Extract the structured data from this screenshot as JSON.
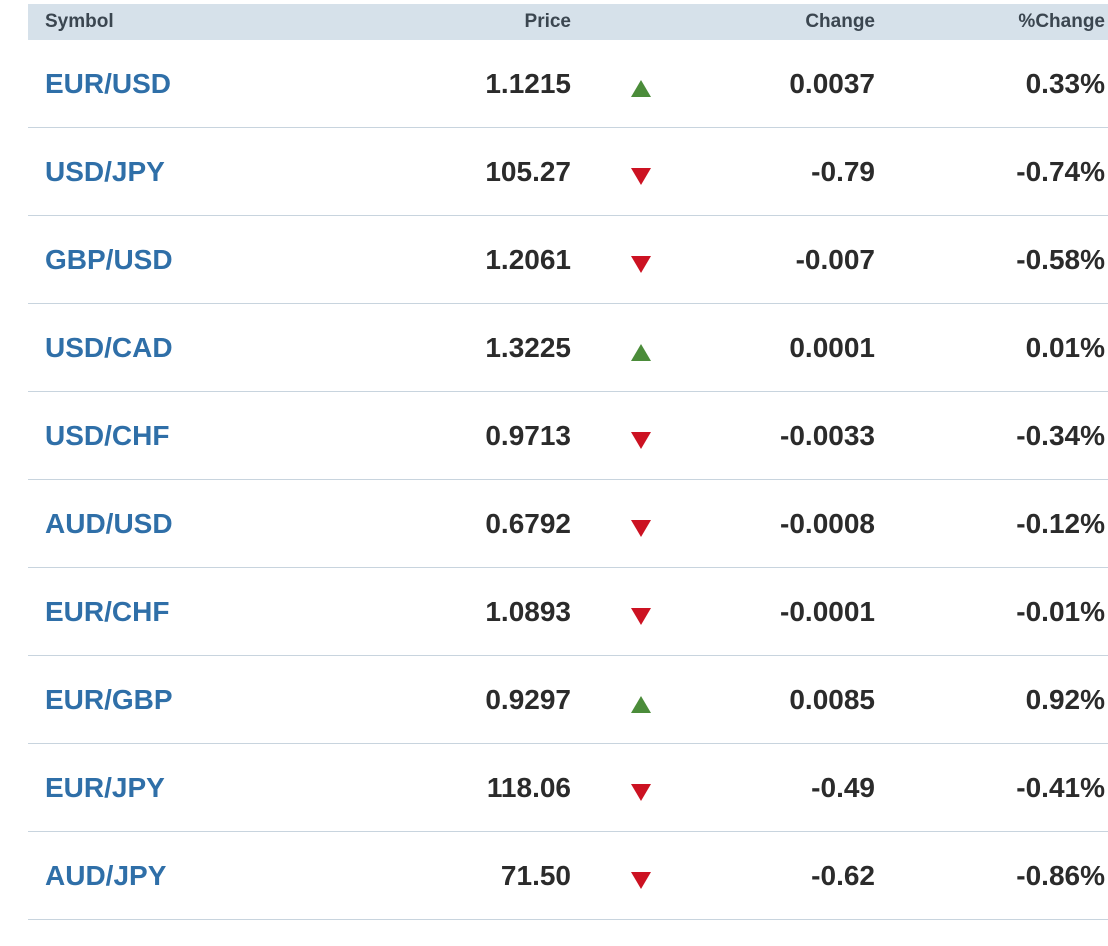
{
  "table": {
    "headers": {
      "symbol": "Symbol",
      "price": "Price",
      "change": "Change",
      "pct_change": "%Change"
    },
    "rows": [
      {
        "symbol": "EUR/USD",
        "price": "1.1215",
        "direction": "up",
        "change": "0.0037",
        "pct_change": "0.33%"
      },
      {
        "symbol": "USD/JPY",
        "price": "105.27",
        "direction": "down",
        "change": "-0.79",
        "pct_change": "-0.74%"
      },
      {
        "symbol": "GBP/USD",
        "price": "1.2061",
        "direction": "down",
        "change": "-0.007",
        "pct_change": "-0.58%"
      },
      {
        "symbol": "USD/CAD",
        "price": "1.3225",
        "direction": "up",
        "change": "0.0001",
        "pct_change": "0.01%"
      },
      {
        "symbol": "USD/CHF",
        "price": "0.9713",
        "direction": "down",
        "change": "-0.0033",
        "pct_change": "-0.34%"
      },
      {
        "symbol": "AUD/USD",
        "price": "0.6792",
        "direction": "down",
        "change": "-0.0008",
        "pct_change": "-0.12%"
      },
      {
        "symbol": "EUR/CHF",
        "price": "1.0893",
        "direction": "down",
        "change": "-0.0001",
        "pct_change": "-0.01%"
      },
      {
        "symbol": "EUR/GBP",
        "price": "0.9297",
        "direction": "up",
        "change": "0.0085",
        "pct_change": "0.92%"
      },
      {
        "symbol": "EUR/JPY",
        "price": "118.06",
        "direction": "down",
        "change": "-0.49",
        "pct_change": "-0.41%"
      },
      {
        "symbol": "AUD/JPY",
        "price": "71.50",
        "direction": "down",
        "change": "-0.62",
        "pct_change": "-0.86%"
      }
    ]
  },
  "icons": {
    "up": "triangle-up-icon",
    "down": "triangle-down-icon"
  },
  "colors": {
    "header_bg": "#d6e1ea",
    "symbol_link": "#2f6fa8",
    "up": "#4b8c3a",
    "down": "#cc1222",
    "row_divider": "#c8d4de"
  }
}
